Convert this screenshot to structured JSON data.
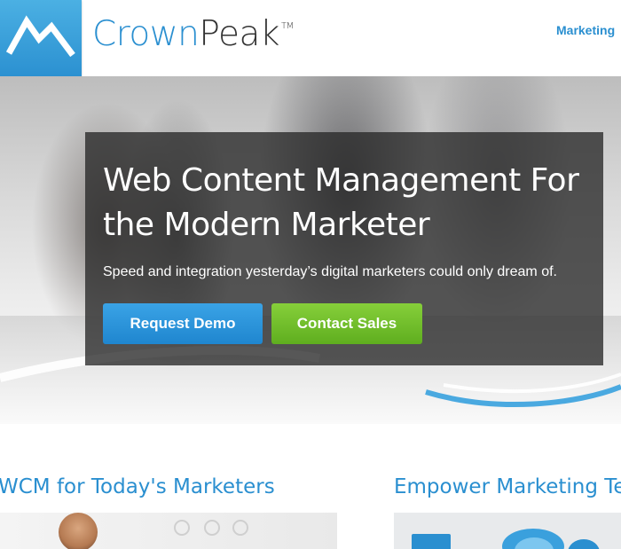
{
  "header": {
    "brand_part1": "Crown",
    "brand_part2": "Peak",
    "brand_tm": "TM",
    "nav_item": "Marketing"
  },
  "hero": {
    "title": "Web Content Management For the Modern Marketer",
    "subtitle": "Speed and integration yesterday’s digital marketers could only dream of.",
    "primary_button": "Request Demo",
    "secondary_button": "Contact Sales"
  },
  "sections": {
    "col1_title": "WCM for Today's Marketers",
    "col2_title": "Empower Marketing Tean"
  },
  "colors": {
    "brand_blue": "#2a8fd0",
    "cta_green": "#6cbc2a",
    "panel_dark": "#282828"
  },
  "icons": {
    "logo": "mountain-logo-icon"
  }
}
